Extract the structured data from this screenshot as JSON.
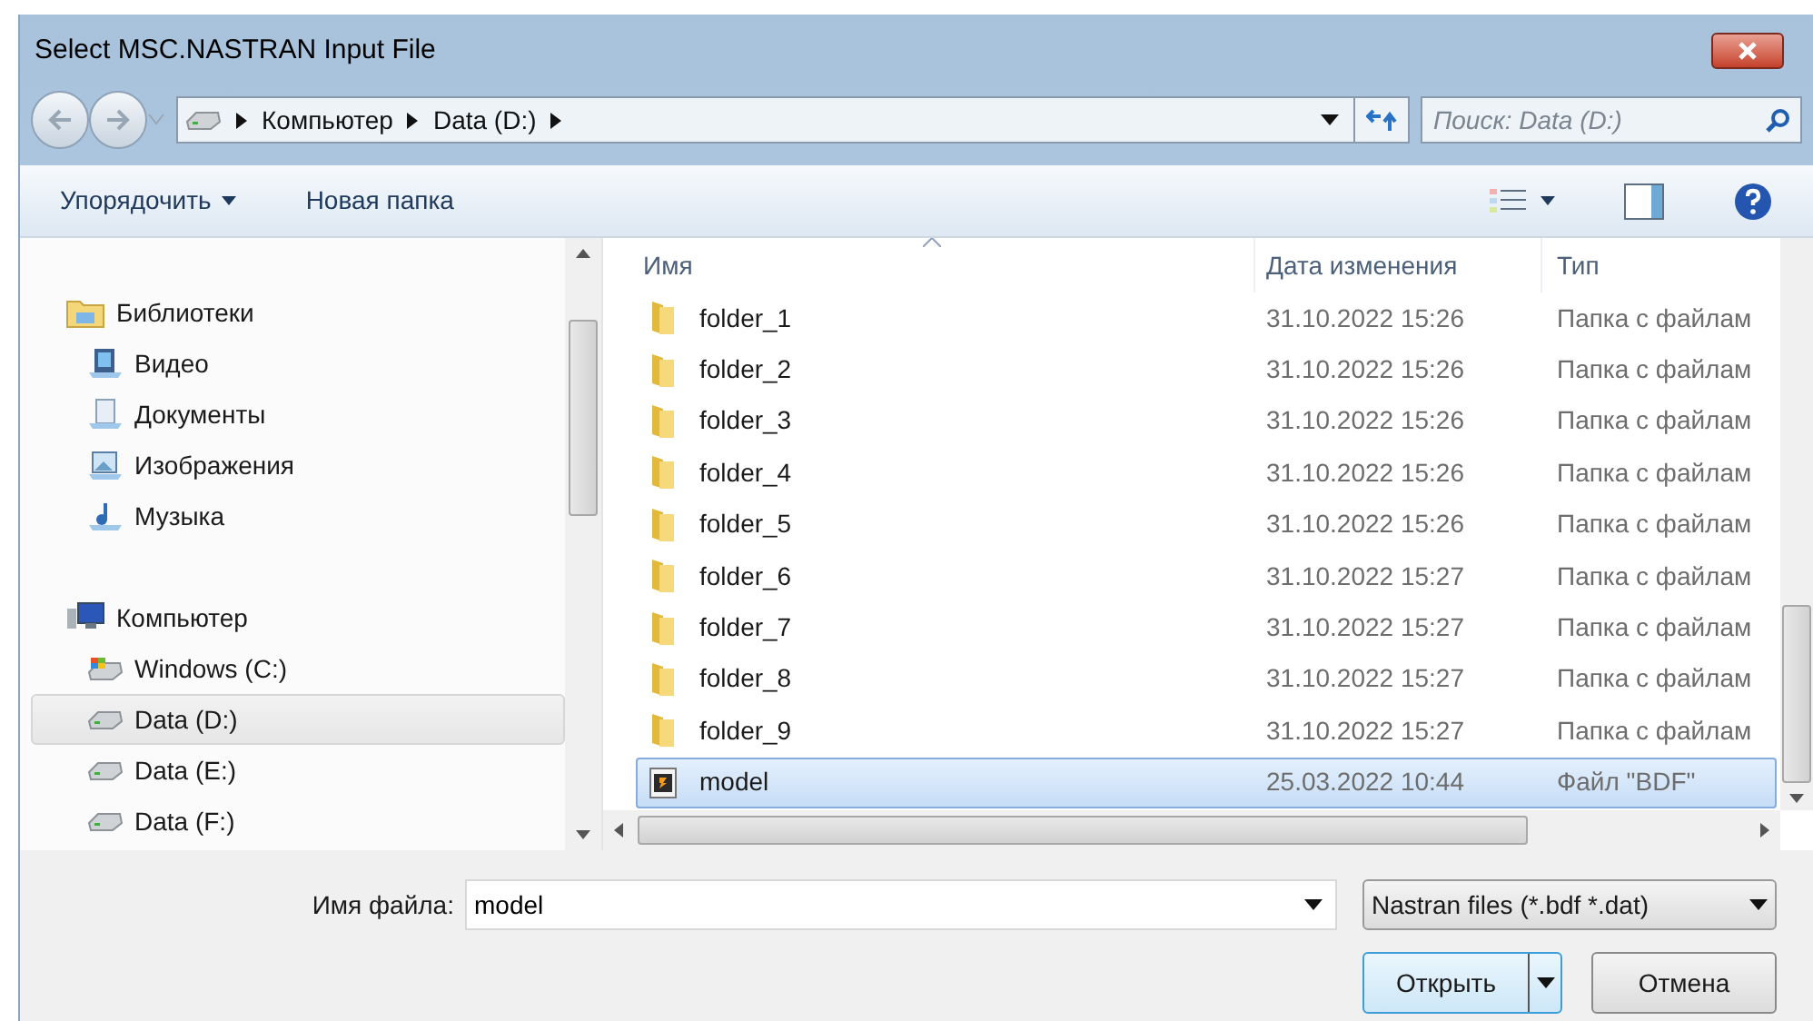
{
  "window": {
    "title": "Select MSC.NASTRAN Input File"
  },
  "address": {
    "crumbs": [
      "Компьютер",
      "Data (D:)"
    ]
  },
  "search": {
    "placeholder": "Поиск: Data (D:)"
  },
  "toolbar": {
    "organize": "Упорядочить",
    "new_folder": "Новая папка"
  },
  "nav": [
    {
      "label": "Библиотеки",
      "kind": "library",
      "selected": false
    },
    {
      "label": "Видео",
      "kind": "video",
      "selected": false
    },
    {
      "label": "Документы",
      "kind": "documents",
      "selected": false
    },
    {
      "label": "Изображения",
      "kind": "images",
      "selected": false
    },
    {
      "label": "Музыка",
      "kind": "music",
      "selected": false
    },
    {
      "label": "Компьютер",
      "kind": "computer",
      "selected": false
    },
    {
      "label": "Windows (C:)",
      "kind": "system-drive",
      "selected": false
    },
    {
      "label": "Data (D:)",
      "kind": "drive",
      "selected": true
    },
    {
      "label": "Data (E:)",
      "kind": "drive",
      "selected": false
    },
    {
      "label": "Data (F:)",
      "kind": "drive",
      "selected": false
    }
  ],
  "table": {
    "columns": [
      "Имя",
      "Дата изменения",
      "Тип"
    ],
    "rows": [
      {
        "name": "folder_1",
        "date": "31.10.2022 15:26",
        "type": "Папка с файлам",
        "kind": "folder",
        "selected": false
      },
      {
        "name": "folder_2",
        "date": "31.10.2022 15:26",
        "type": "Папка с файлам",
        "kind": "folder",
        "selected": false
      },
      {
        "name": "folder_3",
        "date": "31.10.2022 15:26",
        "type": "Папка с файлам",
        "kind": "folder",
        "selected": false
      },
      {
        "name": "folder_4",
        "date": "31.10.2022 15:26",
        "type": "Папка с файлам",
        "kind": "folder",
        "selected": false
      },
      {
        "name": "folder_5",
        "date": "31.10.2022 15:26",
        "type": "Папка с файлам",
        "kind": "folder",
        "selected": false
      },
      {
        "name": "folder_6",
        "date": "31.10.2022 15:27",
        "type": "Папка с файлам",
        "kind": "folder",
        "selected": false
      },
      {
        "name": "folder_7",
        "date": "31.10.2022 15:27",
        "type": "Папка с файлам",
        "kind": "folder",
        "selected": false
      },
      {
        "name": "folder_8",
        "date": "31.10.2022 15:27",
        "type": "Папка с файлам",
        "kind": "folder",
        "selected": false
      },
      {
        "name": "folder_9",
        "date": "31.10.2022 15:27",
        "type": "Папка с файлам",
        "kind": "folder",
        "selected": false
      },
      {
        "name": "model",
        "date": "25.03.2022 10:44",
        "type": "Файл \"BDF\"",
        "kind": "file",
        "selected": true
      }
    ]
  },
  "footer": {
    "filename_label": "Имя файла:",
    "filename": "model",
    "filter": "Nastran files (*.bdf *.dat)",
    "open": "Открыть",
    "cancel": "Отмена"
  }
}
